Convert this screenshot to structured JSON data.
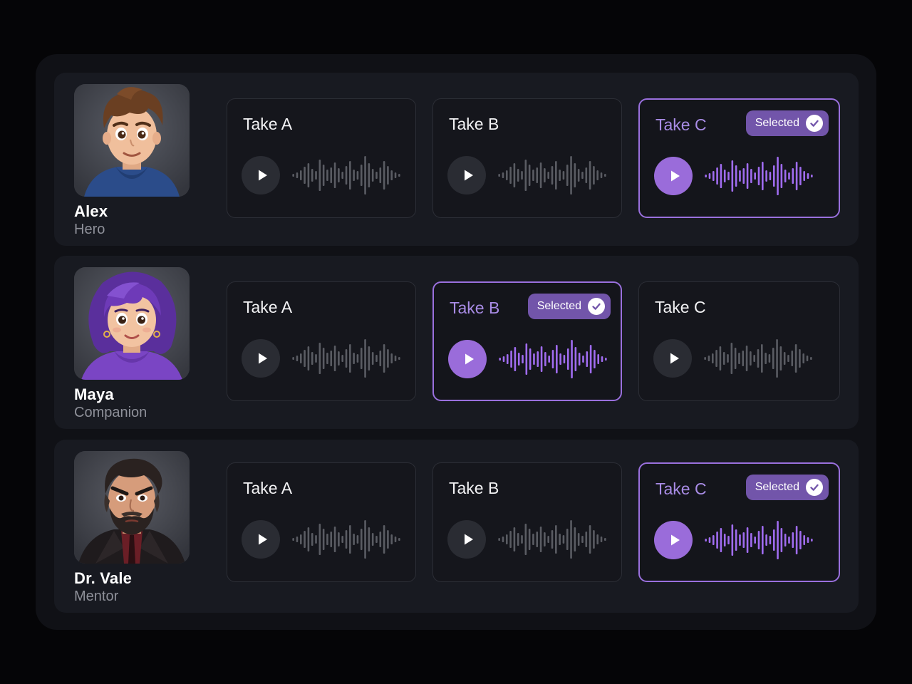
{
  "colors": {
    "accent": "#9a6cda",
    "wave_default": "#5a5c63",
    "wave_selected": "#a06cf0",
    "badge": "#7255aa"
  },
  "icons": {
    "play": "play-icon",
    "check": "check-circle-icon"
  },
  "characters": [
    {
      "name": "Alex",
      "role": "Hero",
      "selected_take": 2,
      "takes": [
        {
          "label": "Take A",
          "selected": false
        },
        {
          "label": "Take B",
          "selected": false
        },
        {
          "label": "Take C",
          "selected": true,
          "badge": "Selected"
        }
      ]
    },
    {
      "name": "Maya",
      "role": "Companion",
      "selected_take": 1,
      "takes": [
        {
          "label": "Take A",
          "selected": false
        },
        {
          "label": "Take B",
          "selected": true,
          "badge": "Selected"
        },
        {
          "label": "Take C",
          "selected": false
        }
      ]
    },
    {
      "name": "Dr. Vale",
      "role": "Mentor",
      "selected_take": 2,
      "takes": [
        {
          "label": "Take A",
          "selected": false
        },
        {
          "label": "Take B",
          "selected": false
        },
        {
          "label": "Take C",
          "selected": true,
          "badge": "Selected"
        }
      ]
    }
  ]
}
